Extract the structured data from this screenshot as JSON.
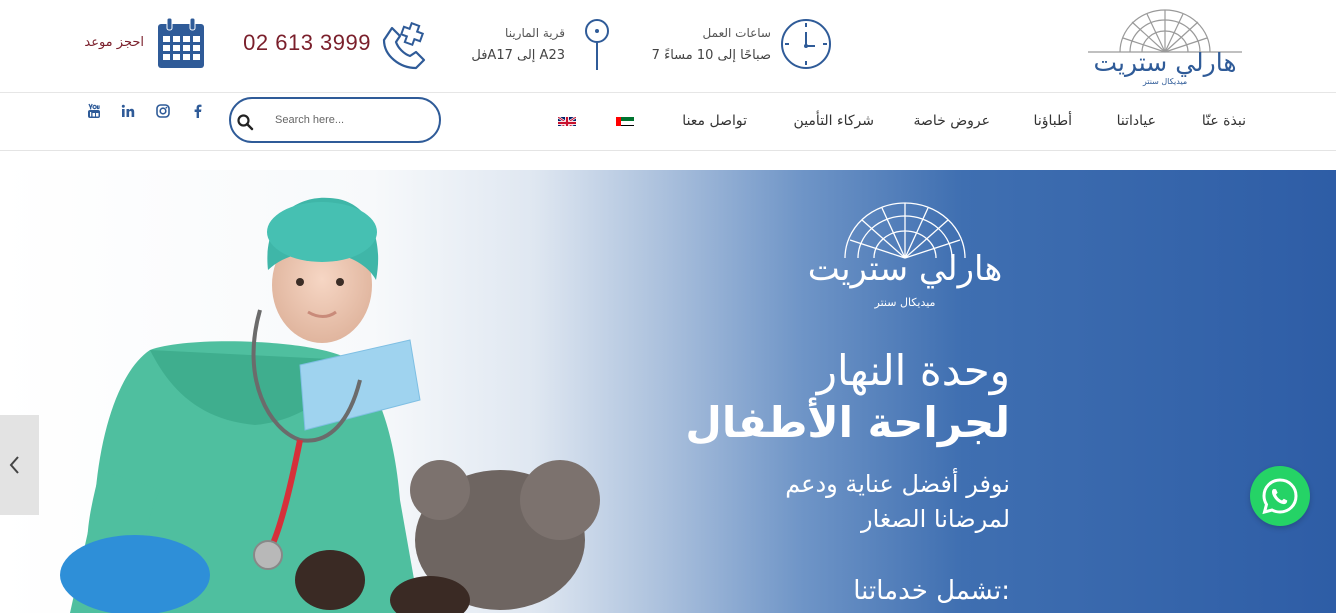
{
  "header": {
    "logo": {
      "name": "هارلي ستريت",
      "subtitle": "ميديكال سنتر"
    },
    "hours": {
      "title": "ساعات العمل",
      "value": "7 صباحًا إلى 10 مساءً"
    },
    "address": {
      "title": "قرية المارينا",
      "value": "فلA17  إلى A23"
    },
    "phone": {
      "number": "02 613 3999"
    },
    "booking": {
      "label": "احجز موعد"
    }
  },
  "nav": {
    "items": [
      {
        "label": "نبذة عنّا"
      },
      {
        "label": "عياداتنا"
      },
      {
        "label": "أطباؤنا"
      },
      {
        "label": "عروض خاصة"
      },
      {
        "label": "شركاء التأمين"
      },
      {
        "label": "تواصل معنا"
      }
    ],
    "languages": [
      {
        "icon": "uae-flag-icon"
      },
      {
        "icon": "uk-flag-icon"
      }
    ],
    "search": {
      "placeholder": "Search here..."
    },
    "social": [
      {
        "icon": "facebook-icon"
      },
      {
        "icon": "instagram-icon"
      },
      {
        "icon": "linkedin-icon"
      },
      {
        "icon": "youtube-icon"
      }
    ]
  },
  "hero": {
    "logo_name": "هارلي ستريت",
    "logo_subtitle": "ميديكال سنتر",
    "line1": "وحدة النهار",
    "line2": "لجراحة الأطفال",
    "line3": "نوفر أفضل عناية ودعم",
    "line4": "لمرضانا الصغار",
    "line5": "تشمل خدماتنا:"
  },
  "colors": {
    "brand_blue": "#2f5b98",
    "brand_maroon": "#7a1f2b",
    "whatsapp_green": "#25d366"
  }
}
